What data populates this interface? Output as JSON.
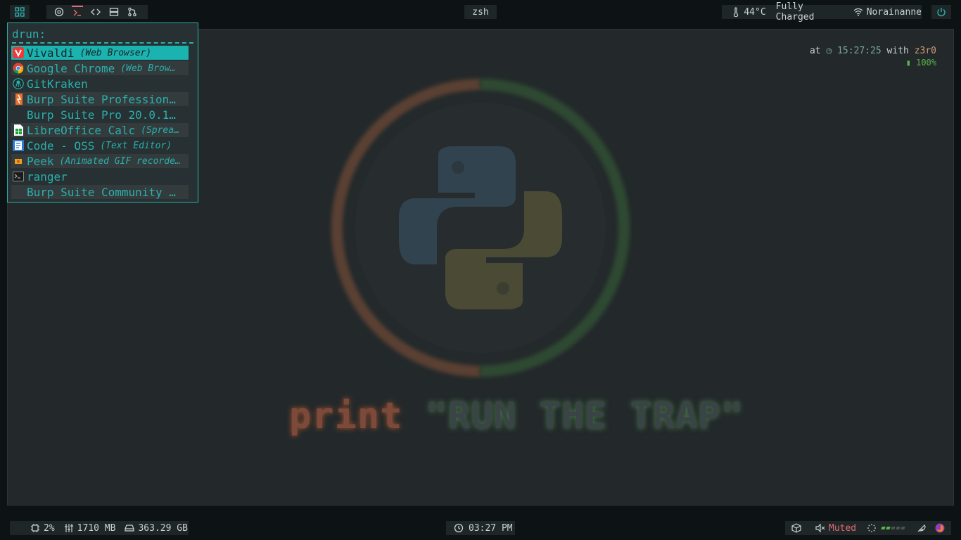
{
  "top_bar": {
    "terminal_title": "zsh",
    "temperature": "44°C",
    "battery_status": "Fully Charged",
    "wifi_name": "Norainanne"
  },
  "desktop": {
    "clock_prefix": "at",
    "clock_time": "15:27:25",
    "clock_with": "with",
    "clock_user": "z3r0",
    "battery_percent": "100%",
    "wallpaper_keyword": "print",
    "wallpaper_string": "\"RUN THE TRAP\""
  },
  "rofi": {
    "prompt": "drun:",
    "items": [
      {
        "name": "Vivaldi",
        "category": "(Web Browser)",
        "icon": "vivaldi-icon"
      },
      {
        "name": "Google Chrome",
        "category": "(Web Brow…",
        "icon": "chrome-icon"
      },
      {
        "name": "GitKraken",
        "category": "",
        "icon": "gitkraken-icon"
      },
      {
        "name": "Burp Suite Profession…",
        "category": "",
        "icon": "burp-icon"
      },
      {
        "name": "Burp Suite Pro 20.0.1…",
        "category": "",
        "icon": ""
      },
      {
        "name": "LibreOffice Calc",
        "category": "(Sprea…",
        "icon": "calc-icon"
      },
      {
        "name": "Code - OSS",
        "category": "(Text Editor)",
        "icon": "code-icon"
      },
      {
        "name": "Peek",
        "category": "(Animated GIF recorde…",
        "icon": "peek-icon"
      },
      {
        "name": "ranger",
        "category": "",
        "icon": "terminal-icon"
      },
      {
        "name": "Burp Suite Community …",
        "category": "",
        "icon": ""
      }
    ]
  },
  "bottom_bar": {
    "cpu": "2%",
    "memory": "1710 MB",
    "disk": "363.29 GB",
    "time": "03:27 PM",
    "volume": "Muted"
  },
  "colors": {
    "accent": "#2ab0ac",
    "selected_bg": "#1ab3b0",
    "muted": "#e06c75",
    "battery": "#5cb34a"
  }
}
